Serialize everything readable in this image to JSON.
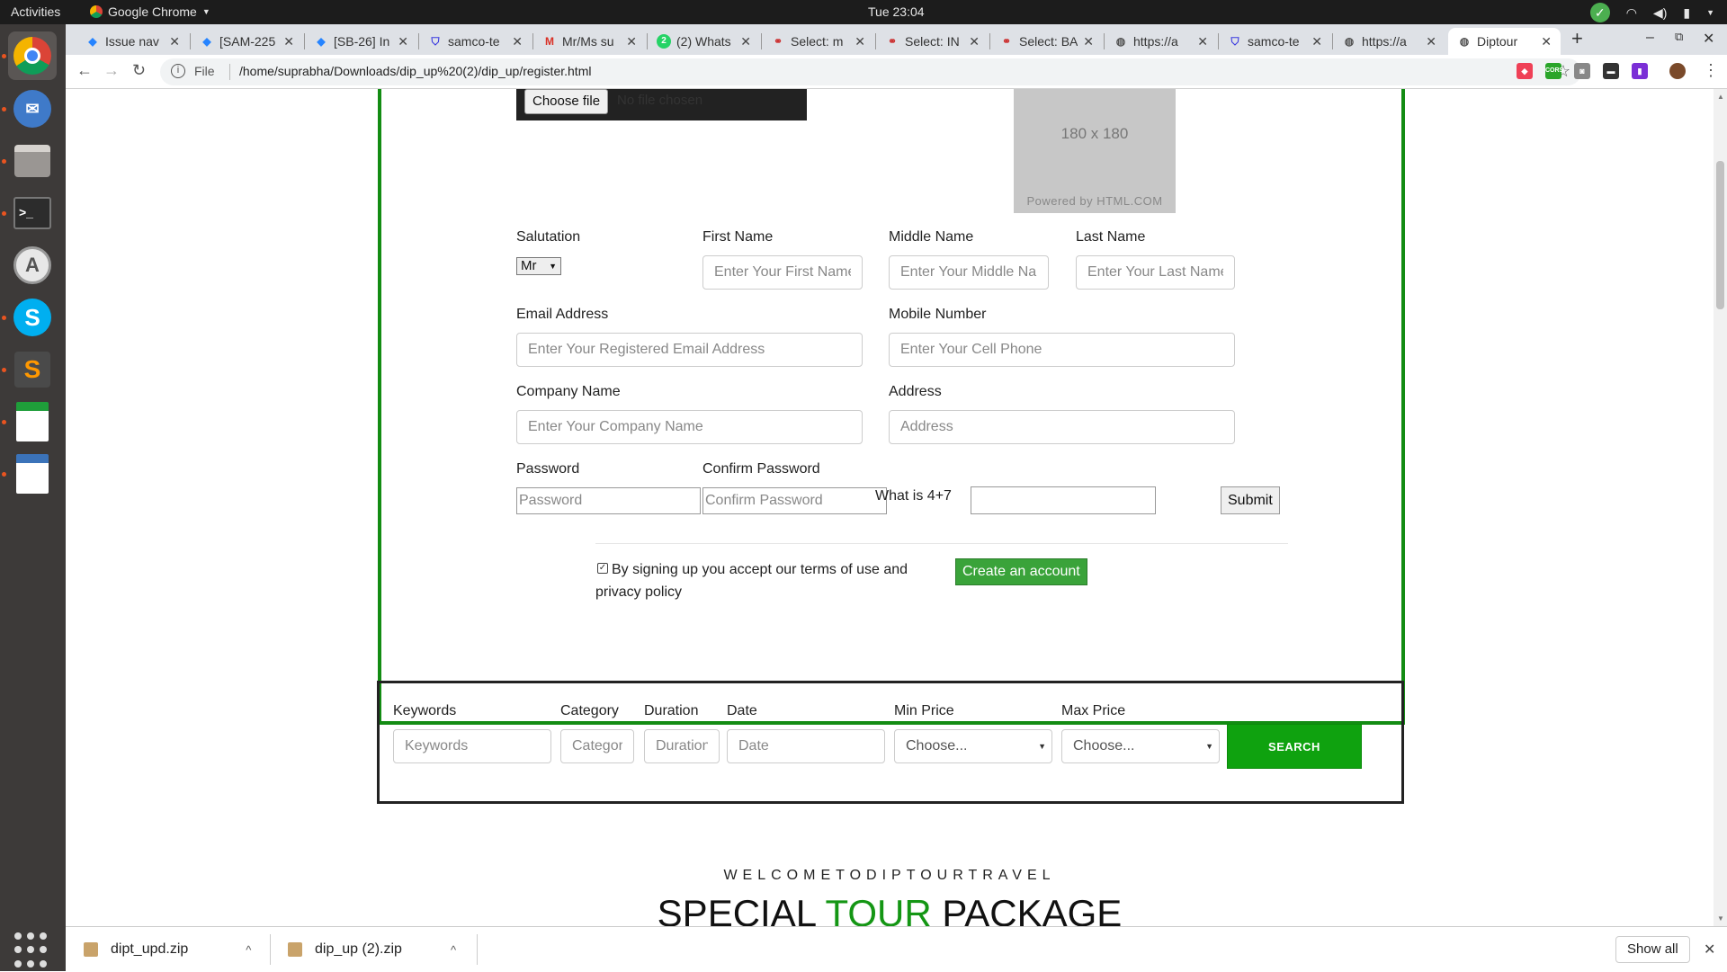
{
  "topbar": {
    "activities": "Activities",
    "app_name": "Google Chrome",
    "clock": "Tue 23:04"
  },
  "dock": {
    "items": [
      "Chrome",
      "Thunderbird",
      "Files",
      "Terminal",
      "Software Updater",
      "Skype",
      "Sublime Text",
      "LibreOffice Calc",
      "Image Viewer"
    ]
  },
  "browser": {
    "tabs": [
      {
        "label": "Issue nav",
        "icon": "jira-icon"
      },
      {
        "label": "[SAM-225",
        "icon": "jira-icon"
      },
      {
        "label": "[SB-26] In",
        "icon": "jira-icon"
      },
      {
        "label": "samco-te",
        "icon": "shield-icon"
      },
      {
        "label": "Mr/Ms su",
        "icon": "gmail-icon"
      },
      {
        "label": "(2) Whats",
        "icon": "whatsapp-icon"
      },
      {
        "label": "Select: m",
        "icon": "link-icon"
      },
      {
        "label": "Select: IN",
        "icon": "link-icon"
      },
      {
        "label": "Select: BA",
        "icon": "link-icon"
      },
      {
        "label": "https://a",
        "icon": "globe-icon"
      },
      {
        "label": "samco-te",
        "icon": "shield-icon"
      },
      {
        "label": "https://a",
        "icon": "globe-icon"
      },
      {
        "label": "Diptour",
        "icon": "globe-icon"
      }
    ],
    "active_tab": "Diptour",
    "address": {
      "scheme": "File",
      "url": "/home/suprabha/Downloads/dip_up%20(2)/dip_up/register.html"
    }
  },
  "register": {
    "file_button": "Choose file",
    "file_status": "No file chosen",
    "photo_size": "180 x 180",
    "photo_credit": "Powered by HTML.COM",
    "salutation_label": "Salutation",
    "salutation_value": "Mr",
    "first_name_label": "First Name",
    "first_name_placeholder": "Enter Your First Name",
    "middle_name_label": "Middle Name",
    "middle_name_placeholder": "Enter Your Middle Name",
    "last_name_label": "Last Name",
    "last_name_placeholder": "Enter Your Last Name",
    "email_label": "Email Address",
    "email_placeholder": "Enter Your Registered Email Address",
    "mobile_label": "Mobile Number",
    "mobile_placeholder": "Enter Your Cell Phone",
    "company_label": "Company Name",
    "company_placeholder": "Enter Your Company Name",
    "address_label": "Address",
    "address_placeholder": "Address",
    "password_label": "Password",
    "password_placeholder": "Password",
    "confirm_label": "Confirm Password",
    "confirm_placeholder": "Confirm Password",
    "captcha_question": "What is 4+7",
    "submit_label": "Submit",
    "terms_text": "By signing up you accept our terms of use and privacy policy",
    "terms_checked": true,
    "create_label": "Create an account"
  },
  "search": {
    "keywords_label": "Keywords",
    "keywords_placeholder": "Keywords",
    "category_label": "Category",
    "category_placeholder": "Category",
    "duration_label": "Duration",
    "duration_placeholder": "Duration",
    "date_label": "Date",
    "date_placeholder": "Date",
    "min_price_label": "Min Price",
    "min_price_value": "Choose...",
    "max_price_label": "Max Price",
    "max_price_value": "Choose...",
    "search_label": "SEARCH"
  },
  "hero": {
    "welcome": "WELCOMETODIPTOURTRAVEL",
    "title_a": "SPECIAL",
    "title_b": "TOUR",
    "title_c": "PACKAGE"
  },
  "downloads": {
    "items": [
      "dipt_upd.zip",
      "dip_up (2).zip"
    ],
    "show_all": "Show all"
  },
  "colors": {
    "accent_green": "#138c13",
    "button_green": "#3aa33a",
    "search_green": "#0fa20f"
  }
}
